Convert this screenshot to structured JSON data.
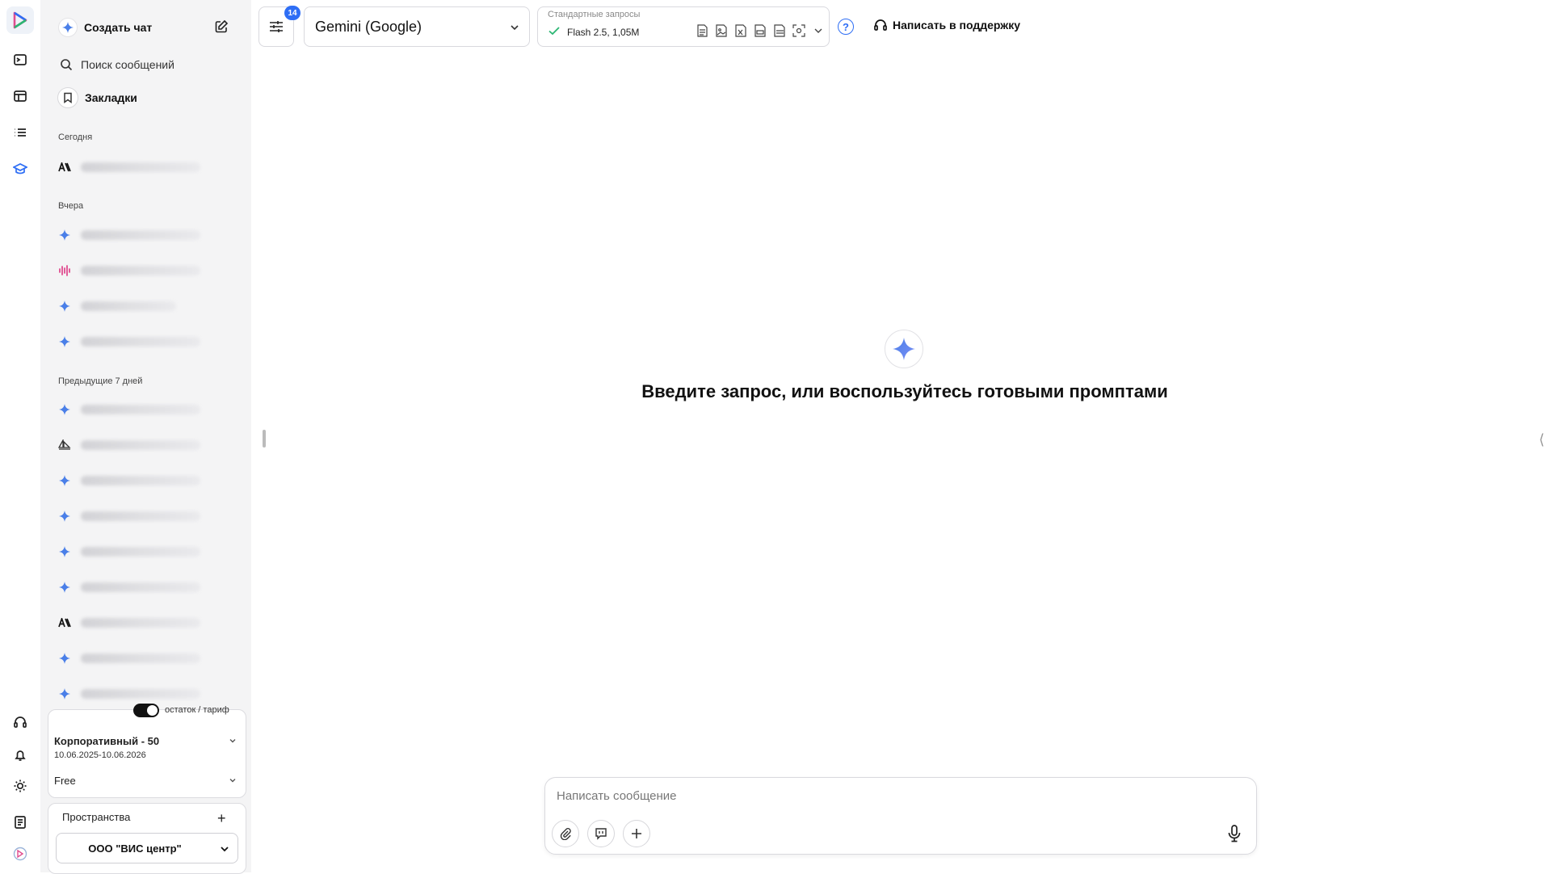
{
  "sidebar": {
    "new_chat": "Создать чат",
    "search": "Поиск сообщений",
    "bookmarks": "Закладки",
    "sections": {
      "today": "Сегодня",
      "yesterday": "Вчера",
      "prev7": "Предыдущие 7 дней"
    },
    "today_items": [
      {
        "icon": "anthropic-icon"
      }
    ],
    "yesterday_items": [
      {
        "icon": "gemini-star-icon"
      },
      {
        "icon": "audio-wave-icon"
      },
      {
        "icon": "gemini-star-icon"
      },
      {
        "icon": "gemini-star-icon"
      }
    ],
    "prev7_items": [
      {
        "icon": "gemini-star-icon"
      },
      {
        "icon": "sail-icon"
      },
      {
        "icon": "gemini-star-icon"
      },
      {
        "icon": "gemini-star-icon"
      },
      {
        "icon": "gemini-star-icon"
      },
      {
        "icon": "gemini-star-icon"
      },
      {
        "icon": "anthropic-icon"
      },
      {
        "icon": "gemini-star-icon"
      },
      {
        "icon": "gemini-star-icon"
      }
    ],
    "toggle_label": "остаток / тариф",
    "plan_name": "Корпоративный - 50",
    "plan_dates": "10.06.2025-10.06.2026",
    "plan_free": "Free",
    "spaces_title": "Пространства",
    "space_selected": "ООО \"ВИС центр\""
  },
  "topbar": {
    "badge": "14",
    "model": "Gemini (Google)",
    "requests_label": "Стандартные запросы",
    "requests_value": "Flash 2.5, 1,05M",
    "help": "?",
    "support": "Написать в поддержку"
  },
  "main": {
    "hero_text": "Введите запрос, или воспользуйтесь готовыми промптами"
  },
  "composer": {
    "placeholder": "Написать сообщение"
  },
  "colors": {
    "accent": "#2e6ef5",
    "sidebar_bg": "#f4f4f5",
    "gemini_blue": "#4a7fe8",
    "audio_pink": "#e04b8f"
  }
}
